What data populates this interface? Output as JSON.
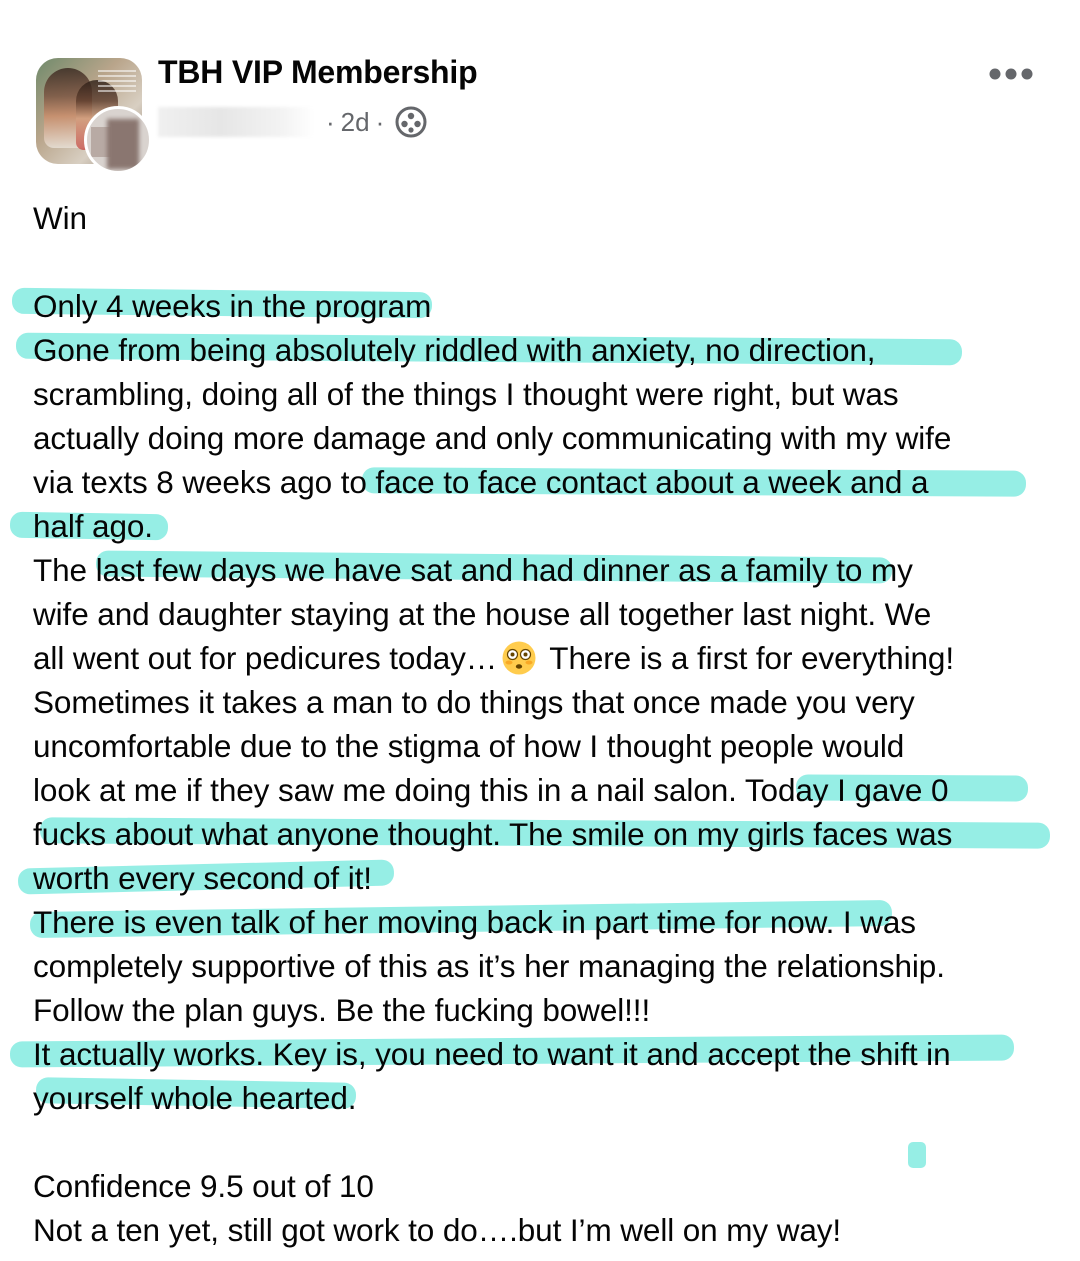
{
  "post": {
    "group_name": "TBH VIP Membership",
    "time": "2d",
    "separator": "·",
    "privacy_icon": "globe-icon",
    "more_icon": "more-options-icon"
  },
  "body": {
    "lines": [
      "Win",
      "Only 4 weeks in the program",
      "Gone from being absolutely riddled with anxiety, no direction,",
      "scrambling, doing all of the things I thought were right, but was",
      "actually doing more damage and only communicating with my wife",
      "via texts 8 weeks ago to face to face contact about a week and a",
      "half ago.",
      "The last few days we have sat and had dinner as a family to my",
      "wife and daughter staying at the house all together last night. We",
      "all went out for pedicures today…",
      "There is a first for everything!",
      "Sometimes it takes a man to do things that once made you very",
      "uncomfortable due to the stigma of how I thought people would",
      "look at me if they saw me doing this in a nail salon. Today I gave 0",
      "fucks about what anyone thought. The smile on my girls faces was",
      "worth every second of it!",
      "There is even talk of her moving back in part time for now. I was",
      "completely supportive of this as it’s her managing the relationship.",
      "Follow the plan guys. Be the fucking bowel!!!",
      "It actually works. Key is, you need to want it and accept the shift in",
      "yourself whole hearted.",
      "Confidence 9.5 out of 10",
      "Not a ten yet, still got work to do….but I’m well on my way!"
    ],
    "emoji": "flushed-face-emoji",
    "highlight_color": "#6EE7DB"
  }
}
